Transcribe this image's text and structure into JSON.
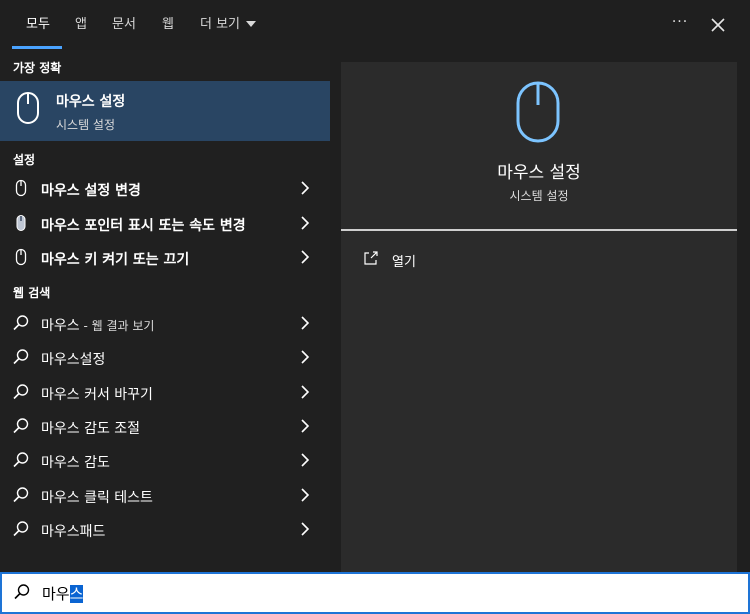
{
  "tabs": [
    {
      "label": "모두",
      "active": true
    },
    {
      "label": "앱"
    },
    {
      "label": "문서"
    },
    {
      "label": "웹"
    },
    {
      "label": "더 보기"
    }
  ],
  "window_controls": {
    "more_label": "···",
    "close_icon": "close-icon"
  },
  "sections": {
    "best_match": "가장 정확",
    "settings": "설정",
    "web_search": "웹 검색"
  },
  "best_match": {
    "title": "마우스 설정",
    "subtitle": "시스템 설정",
    "icon": "mouse-icon"
  },
  "settings_items": [
    {
      "label": "마우스 설정 변경",
      "icon": "mouse-icon"
    },
    {
      "label": "마우스 포인터 표시 또는 속도 변경",
      "icon": "mouse-pointer-icon"
    },
    {
      "label": "마우스 키 켜기 또는 끄기",
      "icon": "mouse-icon"
    }
  ],
  "web_items": [
    {
      "label": "마우스",
      "suffix": " - 웹 결과 보기"
    },
    {
      "label": "마우스설정"
    },
    {
      "label": "마우스 커서 바꾸기"
    },
    {
      "label": "마우스 감도 조절"
    },
    {
      "label": "마우스 감도"
    },
    {
      "label": "마우스 클릭 테스트"
    },
    {
      "label": "마우스패드"
    }
  ],
  "preview": {
    "title": "마우스 설정",
    "subtitle": "시스템 설정",
    "open_label": "열기"
  },
  "search": {
    "typed": "마우",
    "selected": "스"
  },
  "colors": {
    "accent": "#4aa3ff",
    "selected_row": "#294563",
    "search_border": "#1e74d6"
  }
}
